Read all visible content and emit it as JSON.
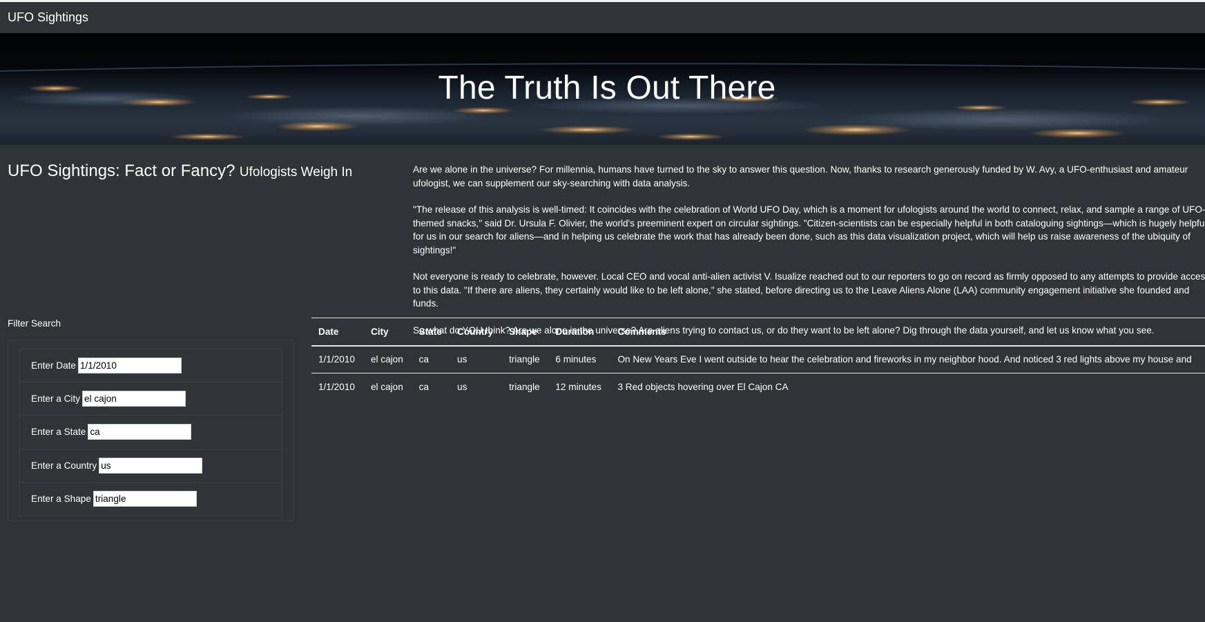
{
  "navbar": {
    "brand": "UFO Sightings"
  },
  "hero": {
    "title": "The Truth Is Out There"
  },
  "article": {
    "title": "UFO Sightings: Fact or Fancy?",
    "subtitle": "Ufologists Weigh In",
    "paragraphs": [
      "Are we alone in the universe? For millennia, humans have turned to the sky to answer this question. Now, thanks to research generously funded by W. Avy, a UFO-enthusiast and amateur ufologist, we can supplement our sky-searching with data analysis.",
      "\"The release of this analysis is well-timed: It coincides with the celebration of World UFO Day, which is a moment for ufologists around the world to connect, relax, and sample a range of UFO-themed snacks,\" said Dr. Ursula F. Olivier, the world's preeminent expert on circular sightings. \"Citizen-scientists can be especially helpful in both cataloguing sightings—which is hugely helpful for us in our search for aliens—and in helping us celebrate the work that has already been done, such as this data visualization project, which will help us raise awareness of the ubiquity of sightings!\"",
      "Not everyone is ready to celebrate, however. Local CEO and vocal anti-alien activist V. Isualize reached out to our reporters to go on record as firmly opposed to any attempts to provide access to this data. \"If there are aliens, they certainly would like to be left alone,\" she stated, before directing us to the Leave Aliens Alone (LAA) community engagement initiative she founded and funds.",
      "So what do YOU think? Are we alone in the universe? Are aliens trying to contact us, or do they want to be left alone? Dig through the data yourself, and let us know what you see."
    ]
  },
  "filters": {
    "heading": "Filter Search",
    "items": [
      {
        "label": "Enter Date",
        "value": "1/1/2010"
      },
      {
        "label": "Enter a City",
        "value": "el cajon"
      },
      {
        "label": "Enter a State",
        "value": "ca"
      },
      {
        "label": "Enter a Country",
        "value": "us"
      },
      {
        "label": "Enter a Shape",
        "value": "triangle"
      }
    ]
  },
  "table": {
    "headers": [
      "Date",
      "City",
      "State",
      "Country",
      "Shape",
      "Duration",
      "Comments"
    ],
    "rows": [
      [
        "1/1/2010",
        "el cajon",
        "ca",
        "us",
        "triangle",
        "6 minutes",
        "On New Years Eve I went outside to hear the celebration and fireworks in my neighbor hood. And noticed 3 red lights above my house and"
      ],
      [
        "1/1/2010",
        "el cajon",
        "ca",
        "us",
        "triangle",
        "12 minutes",
        "3 Red objects hovering over El Cajon CA"
      ]
    ]
  },
  "colors": {
    "background": "#2f3437",
    "text": "#ffffff",
    "rule": "#e6e6e6"
  }
}
